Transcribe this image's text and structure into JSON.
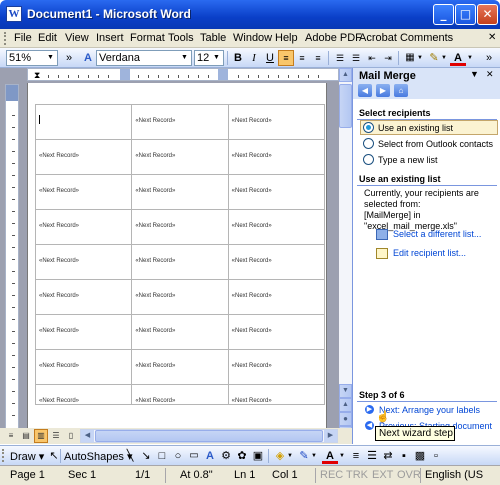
{
  "title": "Document1 - Microsoft Word",
  "menu": [
    "File",
    "Edit",
    "View",
    "Insert",
    "Format",
    "Tools",
    "Table",
    "Window",
    "Help",
    "Adobe PDF",
    "Acrobat Comments"
  ],
  "toolbar": {
    "zoom": "51%",
    "font": "Verdana",
    "size": "12"
  },
  "table": {
    "first_row": [
      "",
      "«Next Record»",
      "«Next Record»"
    ],
    "rows": [
      [
        "«Next Record»",
        "«Next Record»",
        "«Next Record»"
      ],
      [
        "«Next Record»",
        "«Next Record»",
        "«Next Record»"
      ],
      [
        "«Next Record»",
        "«Next Record»",
        "«Next Record»"
      ],
      [
        "«Next Record»",
        "«Next Record»",
        "«Next Record»"
      ],
      [
        "«Next Record»",
        "«Next Record»",
        "«Next Record»"
      ],
      [
        "«Next Record»",
        "«Next Record»",
        "«Next Record»"
      ],
      [
        "«Next Record»",
        "«Next Record»",
        "«Next Record»"
      ],
      [
        "«Next Record»",
        "«Next Record»",
        "«Next Record»"
      ],
      [
        "«Next Record»",
        "«Next Record»",
        "«Next Record»"
      ]
    ]
  },
  "pane": {
    "title": "Mail Merge",
    "select_heading": "Select recipients",
    "options": [
      "Use an existing list",
      "Select from Outlook contacts",
      "Type a new list"
    ],
    "existing_heading": "Use an existing list",
    "existing_text1": "Currently, your recipients are",
    "existing_text2": "selected from:",
    "source": "[MailMerge] in \"excel_mail_merge.xls\"",
    "link_select": "Select a different list...",
    "link_edit": "Edit recipient list...",
    "step": "Step 3 of 6",
    "next": "Next: Arrange your labels",
    "prev": "Previous: Starting document",
    "tooltip": "Next wizard step"
  },
  "drawbar": {
    "draw": "Draw ▾",
    "autoshapes": "AutoShapes ▾"
  },
  "status": {
    "page": "Page 1",
    "sec": "Sec 1",
    "pages": "1/1",
    "at": "At 0.8\"",
    "ln": "Ln 1",
    "col": "Col 1",
    "rec": "REC",
    "trk": "TRK",
    "ext": "EXT",
    "ovr": "OVR",
    "lang": "English (US"
  }
}
